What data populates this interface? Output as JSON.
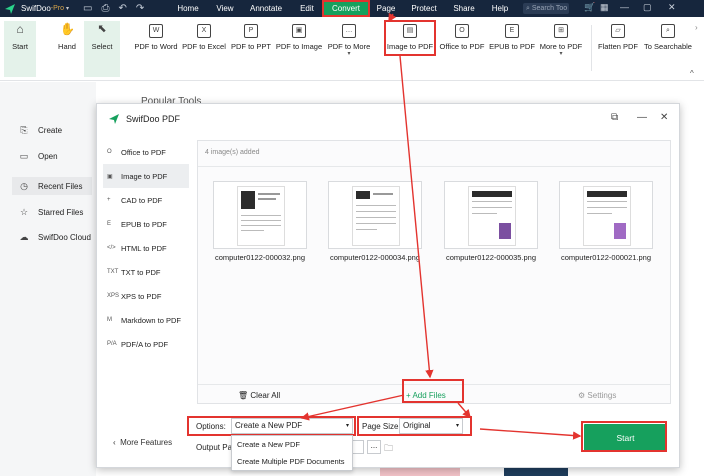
{
  "titlebar": {
    "app_name": "SwifDoo",
    "pro_label": "-Pro",
    "pro_caret": "▾",
    "menus": [
      "Home",
      "View",
      "Annotate",
      "Edit",
      "Convert",
      "Page",
      "Protect",
      "Share",
      "Help"
    ],
    "active_menu": "Convert",
    "search_placeholder": "Search Too"
  },
  "ribbon": {
    "start": "Start",
    "hand": "Hand",
    "select": "Select",
    "tools": [
      {
        "label": "PDF to Word",
        "dd": ""
      },
      {
        "label": "PDF to Excel",
        "dd": ""
      },
      {
        "label": "PDF to PPT",
        "dd": ""
      },
      {
        "label": "PDF to Image",
        "dd": ""
      },
      {
        "label": "PDF to More",
        "dd": "▾"
      },
      {
        "label": "Image to PDF",
        "dd": ""
      },
      {
        "label": "Office to PDF",
        "dd": ""
      },
      {
        "label": "EPUB to PDF",
        "dd": ""
      },
      {
        "label": "More to PDF",
        "dd": "▾"
      },
      {
        "label": "Flatten PDF",
        "dd": ""
      },
      {
        "label": "To Searchable",
        "dd": ""
      }
    ]
  },
  "leftpane": {
    "items": [
      "Create",
      "Open",
      "Recent Files",
      "Starred Files",
      "SwifDoo Cloud"
    ]
  },
  "background": {
    "popular": "Popular Tools"
  },
  "dialog": {
    "title": "SwifDoo PDF",
    "sidebar": [
      {
        "icon": "O",
        "label": "Office to PDF"
      },
      {
        "icon": "▣",
        "label": "Image to PDF"
      },
      {
        "icon": "+",
        "label": "CAD to PDF"
      },
      {
        "icon": "E",
        "label": "EPUB to PDF"
      },
      {
        "icon": "</>",
        "label": "HTML to PDF"
      },
      {
        "icon": "TXT",
        "label": "TXT to PDF"
      },
      {
        "icon": "XPS",
        "label": "XPS to PDF"
      },
      {
        "icon": "M",
        "label": "Markdown to PDF"
      },
      {
        "icon": "P/A",
        "label": "PDF/A to PDF"
      }
    ],
    "more_features": "More Features",
    "image_count": "4 image(s) added",
    "files": [
      "computer0122-000032.png",
      "computer0122-000034.png",
      "computer0122-000035.png",
      "computer0122-000021.png"
    ],
    "clear_all": "Clear All",
    "add_files": "+ Add Files",
    "settings": "Settings",
    "options_label": "Options:",
    "options_value": "Create a New PDF",
    "options_list": [
      "Create a New PDF",
      "Create Multiple PDF Documents"
    ],
    "page_size_label": "Page Size:",
    "page_size_value": "Original",
    "output_label": "Output Path:",
    "output_more": "...",
    "start": "Start"
  },
  "colors": {
    "accent": "#16a05d",
    "annotation": "#e3342f",
    "titlebar": "#16263d"
  }
}
